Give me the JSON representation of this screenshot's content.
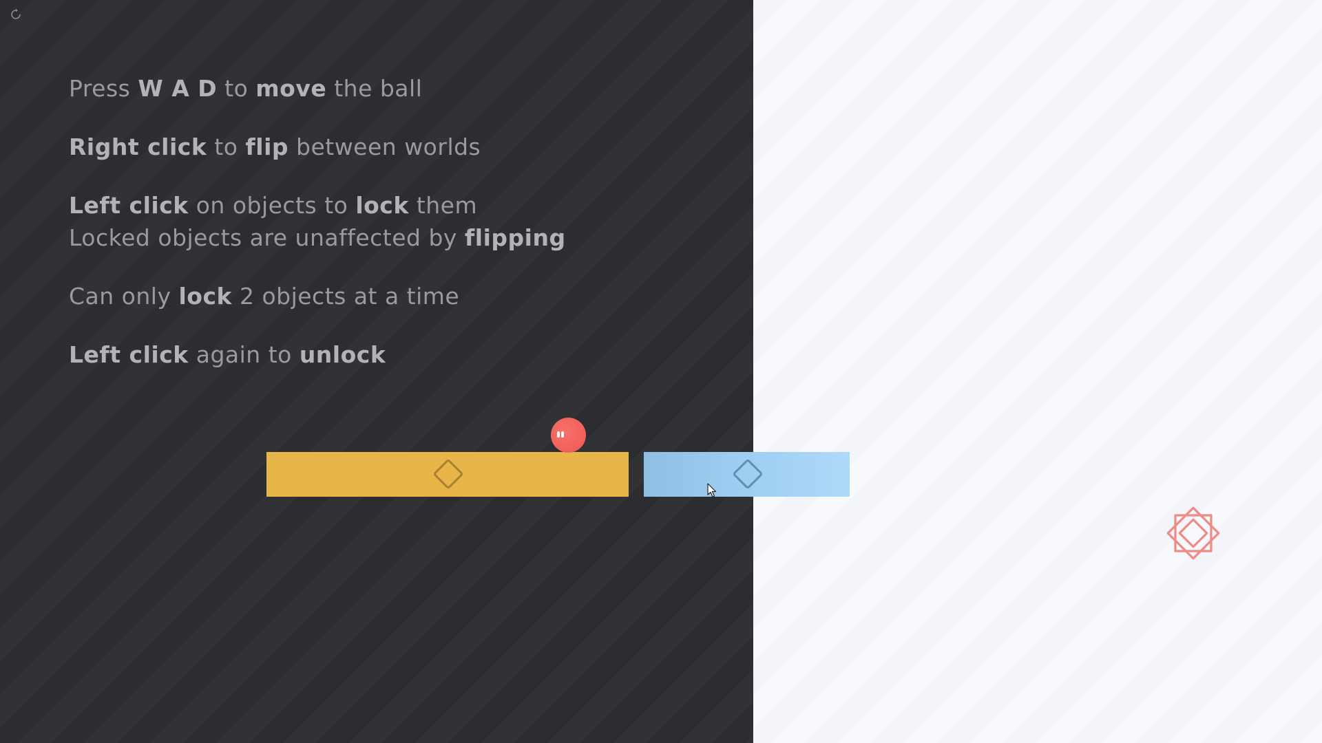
{
  "instructions": [
    {
      "parts": [
        {
          "text": "Press ",
          "bold": false
        },
        {
          "text": "W A D",
          "bold": true
        },
        {
          "text": " to ",
          "bold": false
        },
        {
          "text": "move",
          "bold": true
        },
        {
          "text": " the ball",
          "bold": false
        }
      ]
    },
    {
      "parts": [
        {
          "text": "Right click",
          "bold": true
        },
        {
          "text": " to ",
          "bold": false
        },
        {
          "text": "flip",
          "bold": true
        },
        {
          "text": " between worlds",
          "bold": false
        }
      ]
    },
    {
      "parts": [
        {
          "text": "Left click",
          "bold": true
        },
        {
          "text": " on objects to ",
          "bold": false
        },
        {
          "text": "lock",
          "bold": true
        },
        {
          "text": " them",
          "bold": false
        }
      ]
    },
    {
      "parts": [
        {
          "text": "Locked objects are unaffected by ",
          "bold": false
        },
        {
          "text": "flipping",
          "bold": true
        }
      ]
    },
    {
      "parts": [
        {
          "text": "Can only ",
          "bold": false
        },
        {
          "text": "lock",
          "bold": true
        },
        {
          "text": " 2 objects at a time",
          "bold": false
        }
      ]
    },
    {
      "parts": [
        {
          "text": "Left click",
          "bold": true
        },
        {
          "text": " again to ",
          "bold": false
        },
        {
          "text": "unlock",
          "bold": true
        }
      ]
    }
  ],
  "gaps_after_line": [
    0,
    1,
    3,
    4
  ],
  "icons": {
    "restart": "restart-icon",
    "platform_marker": "diamond-icon",
    "goal": "goal-star-icon",
    "cursor": "mouse-cursor-icon"
  },
  "colors": {
    "dark_world": "#2c2d31",
    "light_world": "#f6f7fc",
    "text": "#9a9ba0",
    "text_bold": "#b2b3b8",
    "yellow_platform": "#e8b549",
    "blue_platform": "#9dcdf0",
    "ball": "#f0605a",
    "goal": "#f08a84"
  }
}
